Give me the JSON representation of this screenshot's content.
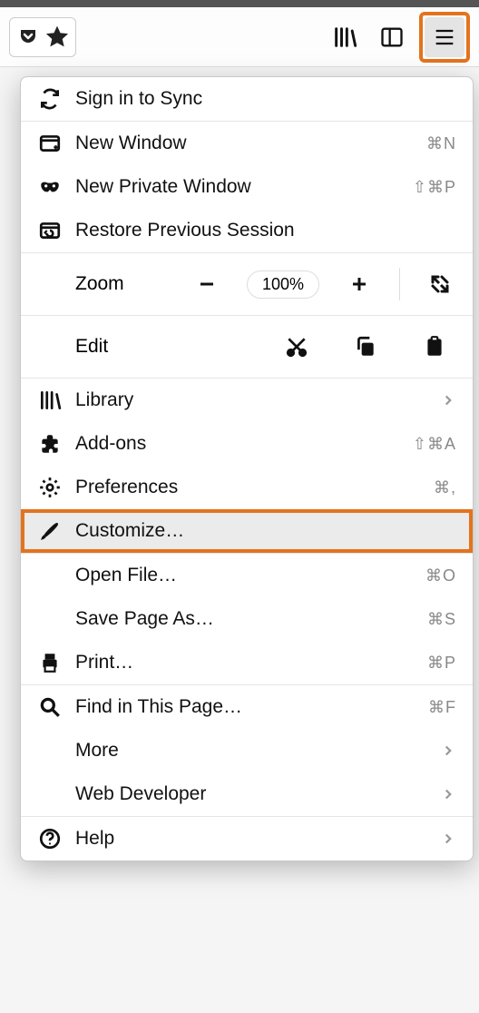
{
  "menu": {
    "sync": "Sign in to Sync",
    "newWindow": {
      "label": "New Window",
      "shortcut": "⌘N"
    },
    "newPrivate": {
      "label": "New Private Window",
      "shortcut": "⇧⌘P"
    },
    "restore": "Restore Previous Session",
    "zoom": {
      "label": "Zoom",
      "level": "100%"
    },
    "edit": {
      "label": "Edit"
    },
    "library": "Library",
    "addons": {
      "label": "Add-ons",
      "shortcut": "⇧⌘A"
    },
    "preferences": {
      "label": "Preferences",
      "shortcut": "⌘,"
    },
    "customize": "Customize…",
    "openFile": {
      "label": "Open File…",
      "shortcut": "⌘O"
    },
    "savePage": {
      "label": "Save Page As…",
      "shortcut": "⌘S"
    },
    "print": {
      "label": "Print…",
      "shortcut": "⌘P"
    },
    "find": {
      "label": "Find in This Page…",
      "shortcut": "⌘F"
    },
    "more": "More",
    "webdev": "Web Developer",
    "help": "Help"
  }
}
